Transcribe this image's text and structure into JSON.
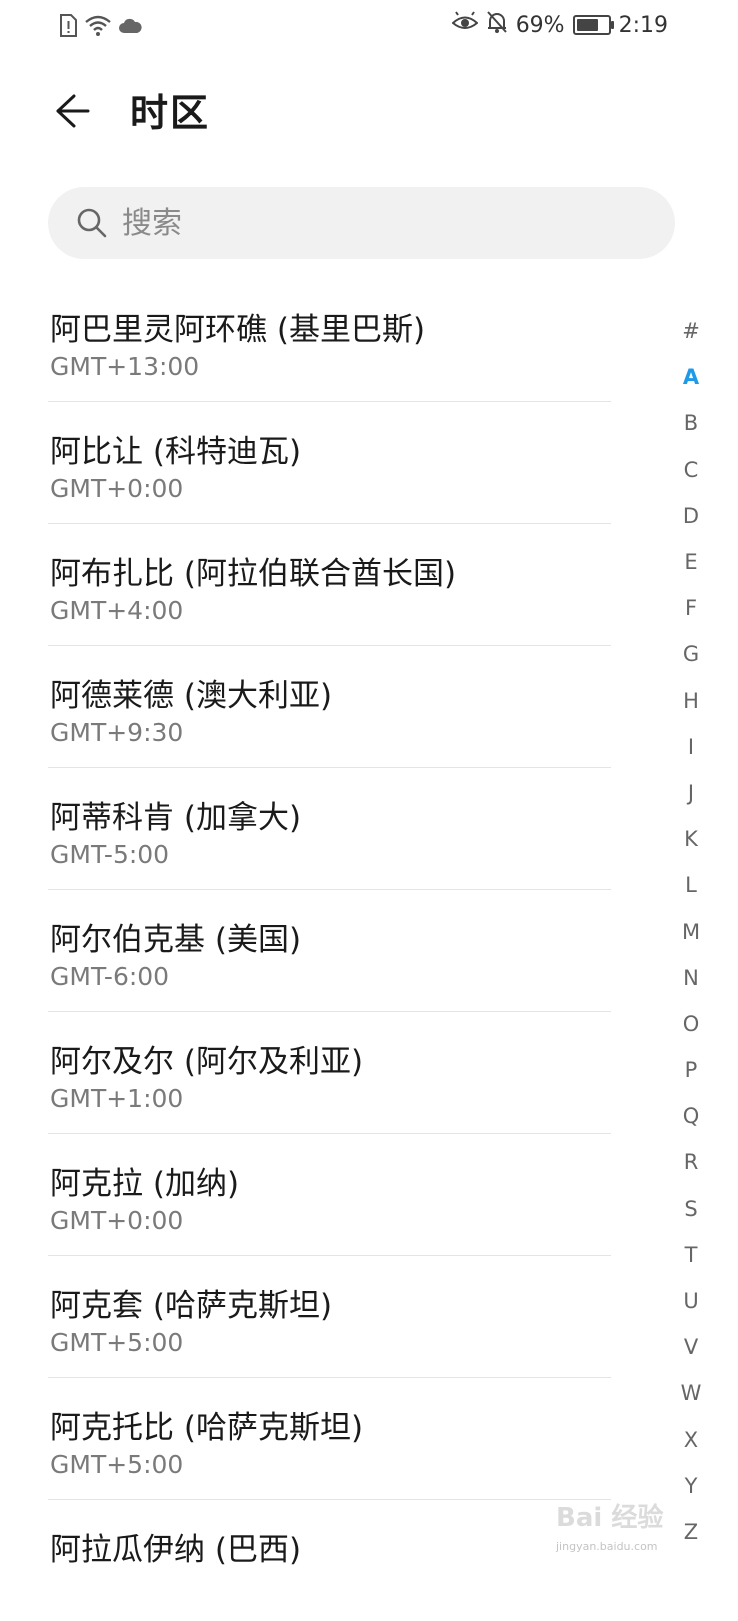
{
  "status_bar": {
    "battery_percent": "69%",
    "battery_level": 0.69,
    "time": "2:19",
    "left_icons": [
      "sim-alert-icon",
      "wifi-icon",
      "cloud-icon"
    ],
    "right_icons": [
      "eye-comfort-icon",
      "bell-off-icon",
      "battery-icon"
    ]
  },
  "header": {
    "title": "时区",
    "back_icon": "arrow-left-icon"
  },
  "search": {
    "placeholder": "搜索",
    "value": ""
  },
  "timezones": [
    {
      "name": "阿巴里灵阿环礁 (基里巴斯)",
      "offset": "GMT+13:00"
    },
    {
      "name": "阿比让 (科特迪瓦)",
      "offset": "GMT+0:00"
    },
    {
      "name": "阿布扎比 (阿拉伯联合酋长国)",
      "offset": "GMT+4:00"
    },
    {
      "name": "阿德莱德 (澳大利亚)",
      "offset": "GMT+9:30"
    },
    {
      "name": "阿蒂科肯 (加拿大)",
      "offset": "GMT-5:00"
    },
    {
      "name": "阿尔伯克基 (美国)",
      "offset": "GMT-6:00"
    },
    {
      "name": "阿尔及尔 (阿尔及利亚)",
      "offset": "GMT+1:00"
    },
    {
      "name": "阿克拉 (加纳)",
      "offset": "GMT+0:00"
    },
    {
      "name": "阿克套 (哈萨克斯坦)",
      "offset": "GMT+5:00"
    },
    {
      "name": "阿克托比 (哈萨克斯坦)",
      "offset": "GMT+5:00"
    },
    {
      "name": "阿拉瓜伊纳 (巴西)",
      "offset": ""
    }
  ],
  "alpha_index": {
    "letters": [
      "#",
      "A",
      "B",
      "C",
      "D",
      "E",
      "F",
      "G",
      "H",
      "I",
      "J",
      "K",
      "L",
      "M",
      "N",
      "O",
      "P",
      "Q",
      "R",
      "S",
      "T",
      "U",
      "V",
      "W",
      "X",
      "Y",
      "Z"
    ],
    "active": "A"
  },
  "colors": {
    "accent": "#1e9be8",
    "search_bg": "#f1f1f1",
    "divider": "#e4e4e4",
    "secondary_text": "#7a7a7a"
  },
  "watermark": {
    "text": "Bai 经验",
    "subtext": "jingyan.baidu.com"
  }
}
